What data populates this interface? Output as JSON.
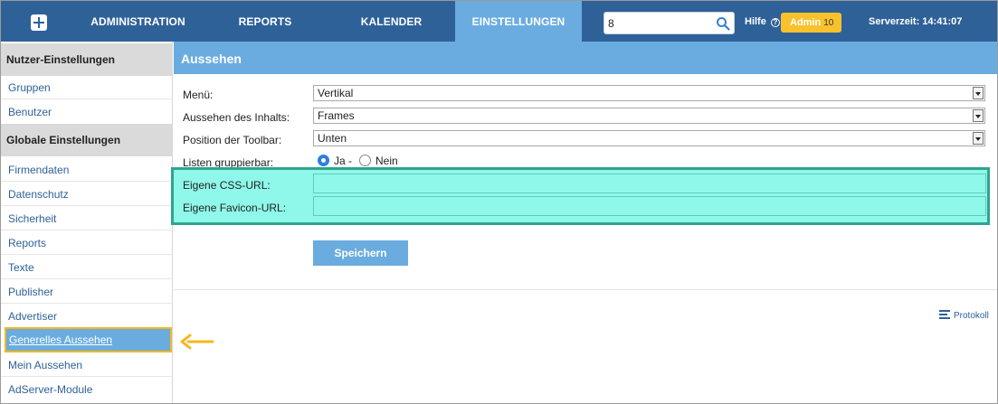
{
  "nav": {
    "items": [
      {
        "label": "ADMINISTRATION"
      },
      {
        "label": "REPORTS"
      },
      {
        "label": "KALENDER"
      },
      {
        "label": "EINSTELLUNGEN",
        "active": true
      }
    ],
    "search_value": "8",
    "help_label": "Hilfe",
    "help_icon": "?",
    "admin_label": "Admin",
    "admin_count": "10",
    "serverzeit": "Serverzeit: 14:41:07"
  },
  "sidebar": {
    "sections": [
      {
        "title": "Nutzer-Einstellungen",
        "items": [
          "Gruppen",
          "Benutzer"
        ]
      },
      {
        "title": "Globale Einstellungen",
        "items": [
          "Firmendaten",
          "Datenschutz",
          "Sicherheit",
          "Reports",
          "Texte",
          "Publisher",
          "Advertiser",
          "Generelles Aussehen",
          "Mein Aussehen",
          "AdServer-Module"
        ]
      }
    ],
    "selected": "Generelles Aussehen"
  },
  "content": {
    "title": "Aussehen",
    "fields": {
      "menu": {
        "label": "Menü:",
        "value": "Vertikal"
      },
      "inhalt": {
        "label": "Aussehen des Inhalts:",
        "value": "Frames"
      },
      "toolbar": {
        "label": "Position der Toolbar:",
        "value": "Unten"
      },
      "listen": {
        "label": "Listen gruppierbar:",
        "option_yes": "Ja -",
        "option_no": "Nein",
        "selected": "Ja -"
      },
      "css_url": {
        "label": "Eigene CSS-URL:",
        "value": ""
      },
      "favicon_url": {
        "label": "Eigene Favicon-URL:",
        "value": ""
      }
    },
    "save_label": "Speichern",
    "protokoll_label": "Protokoll"
  },
  "colors": {
    "nav_bg": "#2f6199",
    "accent": "#6aace0",
    "highlight_fill": "#8ff8ea",
    "highlight_border": "#2ea58f",
    "admin_badge": "#f9c22c",
    "arrow": "#f3b81f"
  }
}
